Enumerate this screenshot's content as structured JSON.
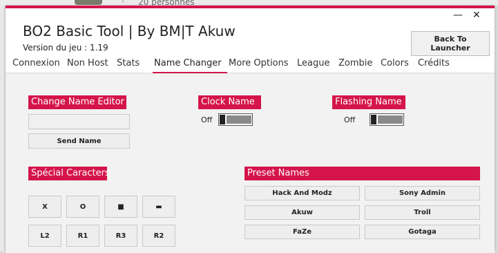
{
  "background": {
    "persons_text": "20 personnes"
  },
  "window": {
    "minimize_glyph": "—",
    "close_glyph": "✕",
    "title": "BO2 Basic Tool | By BM|T Akuw",
    "version": "Version du jeu : 1.19",
    "back_button": "Back To Launcher"
  },
  "tabs": [
    {
      "label": "Connexion"
    },
    {
      "label": "Non Host"
    },
    {
      "label": "Stats"
    },
    {
      "label": "Name Changer"
    },
    {
      "label": "More Options"
    },
    {
      "label": "League"
    },
    {
      "label": "Zombie"
    },
    {
      "label": "Colors"
    },
    {
      "label": "Crédits"
    }
  ],
  "active_tab": "Name Changer",
  "name_editor": {
    "header": "Change Name Editor",
    "input_value": "",
    "send_button": "Send Name"
  },
  "clock_name": {
    "header": "Clock Name",
    "state": "Off"
  },
  "flashing_name": {
    "header": "Flashing Name",
    "state": "Off"
  },
  "special_chars": {
    "header": "Spécial Caracters",
    "buttons": [
      "X",
      "O",
      "■",
      "▬",
      "L2",
      "R1",
      "R3",
      "R2"
    ]
  },
  "preset_names": {
    "header": "Preset Names",
    "buttons": [
      "Hack And Modz",
      "Sony Admin",
      "Akuw",
      "Troll",
      "FaZe",
      "Gotaga"
    ]
  },
  "colors": {
    "accent": "#d4144a",
    "background": "#f2f2f2"
  }
}
